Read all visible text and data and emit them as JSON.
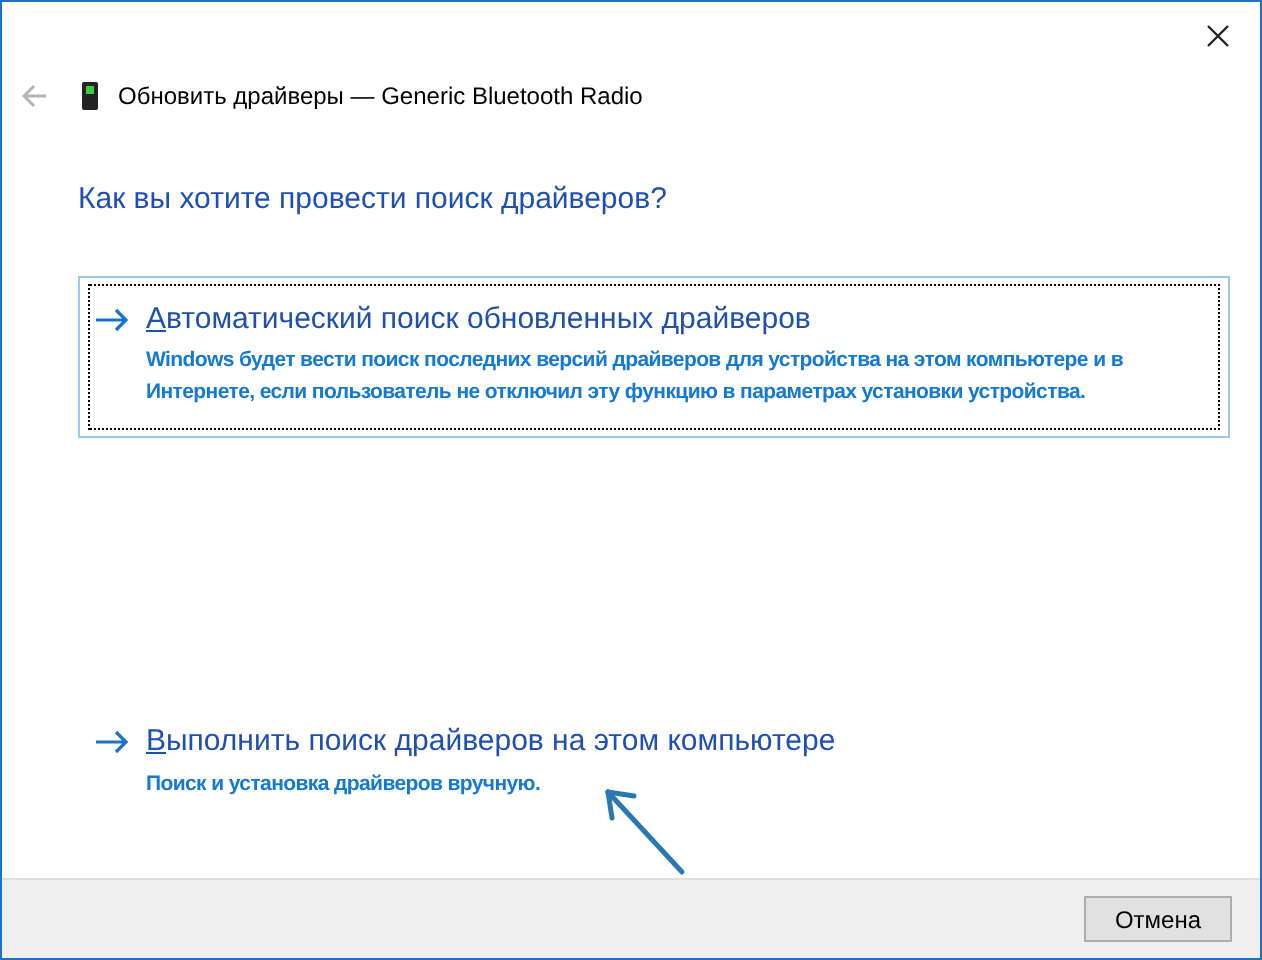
{
  "window": {
    "title": "Обновить драйверы — Generic Bluetooth Radio"
  },
  "heading": "Как вы хотите провести поиск драйверов?",
  "options": [
    {
      "title": "Автоматический поиск обновленных драйверов",
      "description": "Windows будет вести поиск последних версий драйверов для устройства на этом компьютере и в Интернете, если пользователь не отключил эту функцию в параметрах установки устройства.",
      "selected": true
    },
    {
      "title": "Выполнить поиск драйверов на этом компьютере",
      "description": "Поиск и установка драйверов вручную.",
      "selected": false
    }
  ],
  "buttons": [
    "Отмена"
  ]
}
